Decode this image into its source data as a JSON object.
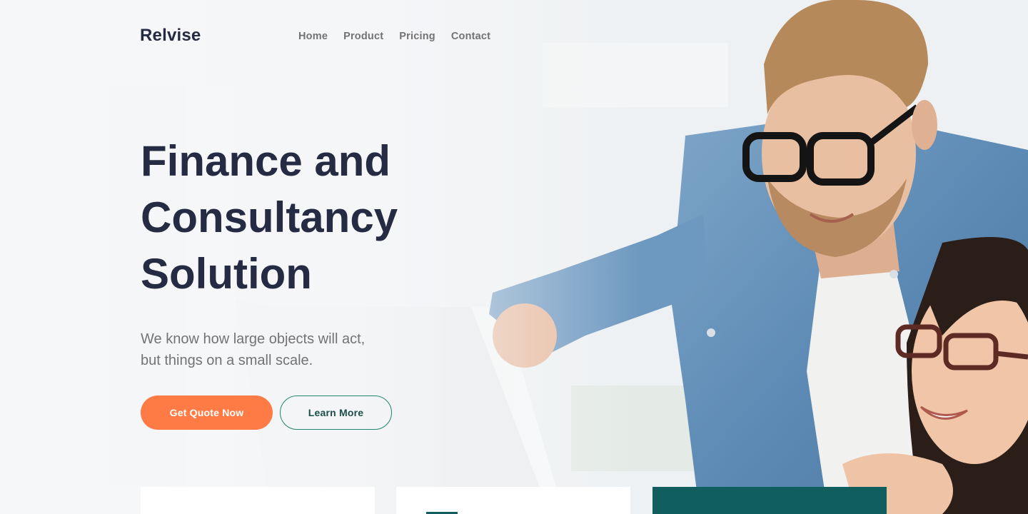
{
  "brand": {
    "name": "Relvise"
  },
  "nav": {
    "items": [
      "Home",
      "Product",
      "Pricing",
      "Contact"
    ]
  },
  "hero": {
    "title_lines": [
      "Finance and",
      "Consultancy",
      "Solution"
    ],
    "description_lines": [
      "We know how large objects will act,",
      "but things on a small scale."
    ],
    "primary_button": "Get Quote Now",
    "secondary_button": "Learn More"
  },
  "colors": {
    "heading": "#252b42",
    "muted": "#737373",
    "primary": "#ff7b45",
    "teal": "#115e5e",
    "outline": "#23856d"
  },
  "icons": [
    "laptop-image",
    "man-with-glasses-image",
    "woman-with-glasses-image"
  ]
}
